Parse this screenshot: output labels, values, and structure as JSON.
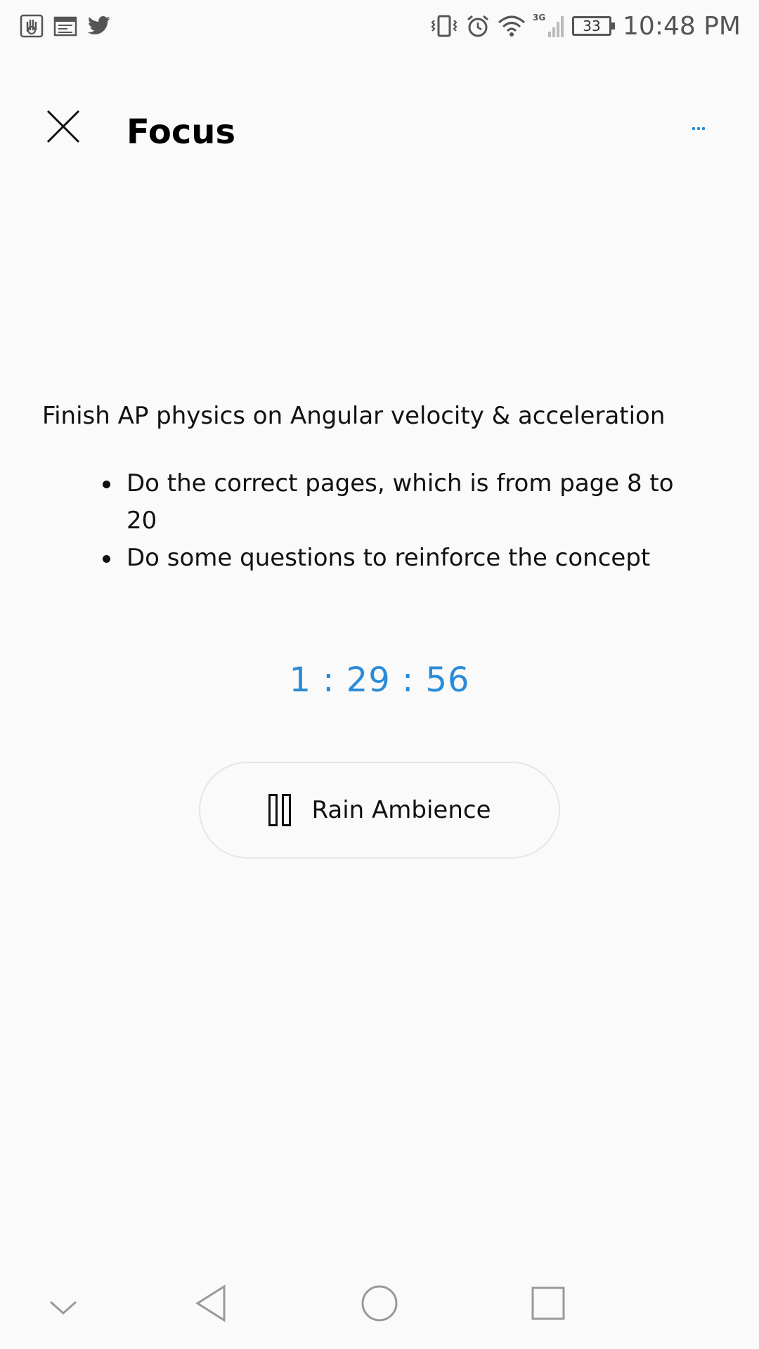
{
  "status_bar": {
    "left_icons": [
      "hand-stop-icon",
      "calendar-icon",
      "twitter-icon"
    ],
    "right_icons": [
      "vibrate-icon",
      "alarm-icon",
      "wifi-icon",
      "signal-3g-icon",
      "battery-icon"
    ],
    "network_label": "3G",
    "battery_level": "33",
    "time": "10:48 PM"
  },
  "app_bar": {
    "title": "Focus",
    "close_icon": "close-icon",
    "more_icon": "more-dots-icon"
  },
  "task": {
    "title": "Finish AP physics on Angular velocity & acceleration",
    "bullets": [
      "Do the correct pages, which is from page 8 to 20",
      "Do some questions to reinforce the concept"
    ]
  },
  "timer": {
    "value": "1 : 29 : 56"
  },
  "ambience": {
    "label": "Rain Ambience",
    "icon": "pause-icon"
  },
  "nav_bar": {
    "buttons": [
      "chevron-down-icon",
      "back-icon",
      "home-icon",
      "recents-icon"
    ]
  },
  "colors": {
    "accent": "#2a8bd8",
    "background": "#fafafa",
    "text": "#111111"
  }
}
